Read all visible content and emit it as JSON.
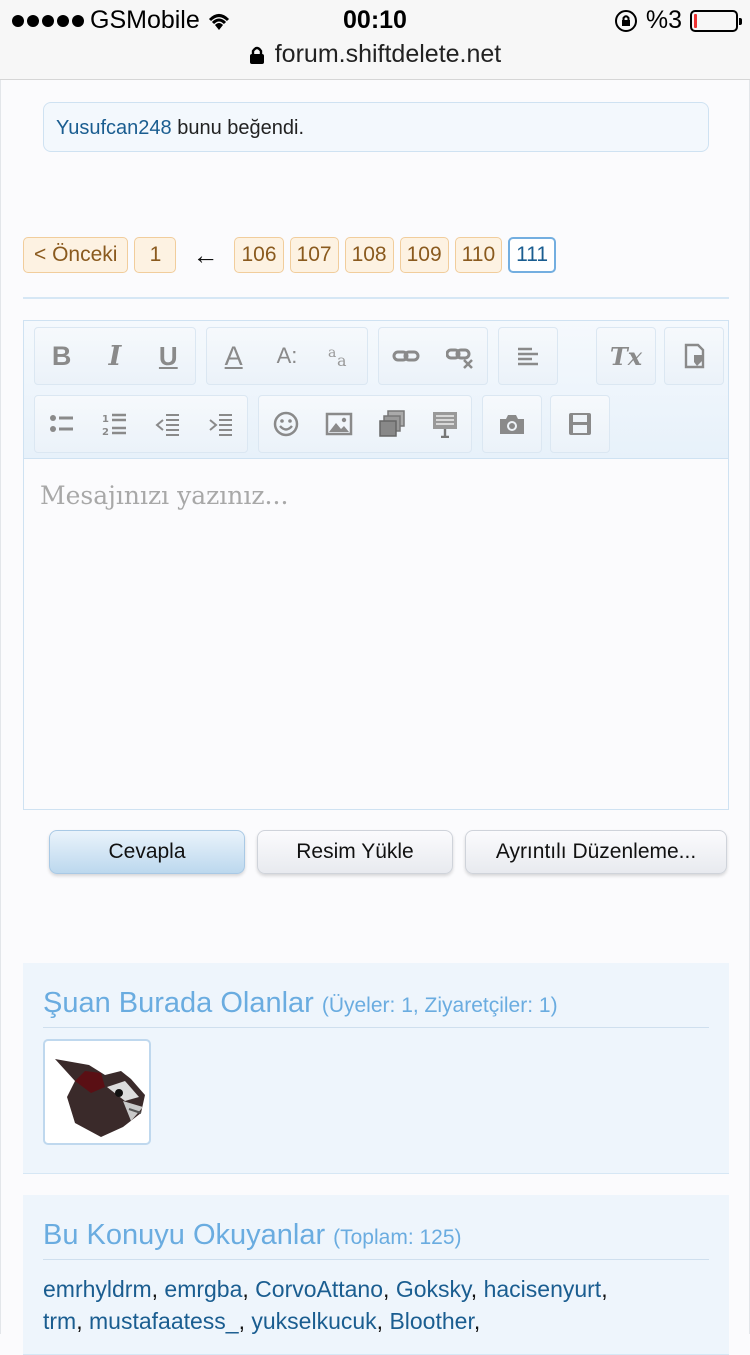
{
  "status": {
    "carrier": "GSMobile",
    "time": "00:10",
    "battery": "%3",
    "battery_level": 0.03
  },
  "browser": {
    "url": "forum.shiftdelete.net"
  },
  "like": {
    "user": "Yusufcan248",
    "text": " bunu beğendi."
  },
  "pagination": {
    "prev": "< Önceki",
    "first": "1",
    "arrow": "←",
    "pages": [
      "106",
      "107",
      "108",
      "109",
      "110"
    ],
    "current": "111"
  },
  "editor": {
    "placeholder": "Mesajınızı yazınız...",
    "toolbar_row1": [
      "bold-icon",
      "italic-icon",
      "underline-icon",
      "text-color-icon",
      "font-size-icon",
      "font-family-icon",
      "link-icon",
      "unlink-icon",
      "align-icon",
      "remove-format-icon",
      "switch-mode-icon"
    ],
    "toolbar_row2": [
      "bullet-list-icon",
      "numbered-list-icon",
      "outdent-icon",
      "indent-icon",
      "smiley-icon",
      "image-icon",
      "media-icon",
      "quote-icon",
      "camera-icon",
      "save-draft-icon"
    ],
    "bold_glyph": "B",
    "italic_glyph": "I",
    "underline_glyph": "U",
    "color_glyph": "A",
    "size_glyph": "A:",
    "clear_glyph": "Tx"
  },
  "buttons": {
    "reply": "Cevapla",
    "upload": "Resim Yükle",
    "advanced": "Ayrıntılı Düzenleme..."
  },
  "online": {
    "title": "Şuan Burada Olanlar",
    "counts": "(Üyeler: 1, Ziyaretçiler: 1)"
  },
  "readers": {
    "title": "Bu Konuyu Okuyanlar",
    "total": "(Toplam: 125)",
    "names": [
      "emrhyldrm",
      "emrgba",
      "CorvoAttano",
      "Goksky",
      "hacisenyurt",
      "trm",
      "mustafaatess_",
      "yukselkucuk",
      "Bloother"
    ]
  }
}
